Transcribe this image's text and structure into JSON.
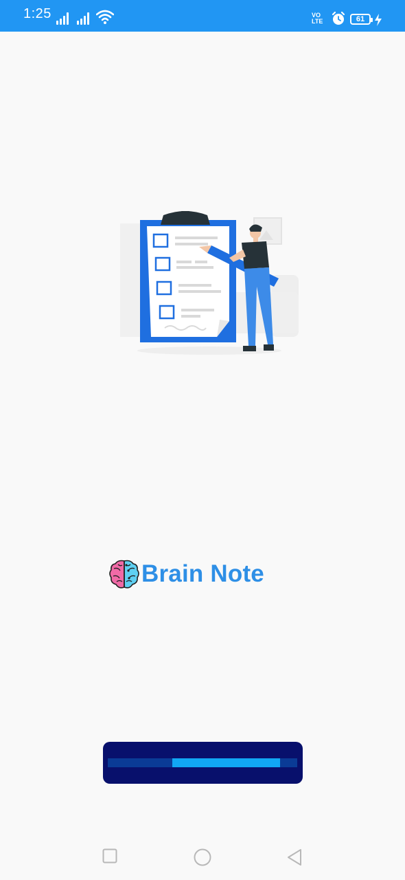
{
  "status_bar": {
    "time": "1:25",
    "volte_line1": "VO",
    "volte_line2": "LTE",
    "battery_level": "61",
    "background_color": "#2196f3"
  },
  "illustration": {
    "icon": "clipboard-checklist-illustration"
  },
  "brand": {
    "logo_icon": "brain-icon",
    "title": "Brain Note",
    "title_color": "#2e8fe6"
  },
  "progress": {
    "state": "indeterminate",
    "segment_start_fraction": 0.34,
    "segment_end_fraction": 0.91,
    "track_color": "#0a3b96",
    "fill_color": "#11a7f4",
    "card_color": "#08106c"
  },
  "nav_bar": {
    "recents_icon": "square-icon",
    "home_icon": "circle-icon",
    "back_icon": "triangle-back-icon"
  }
}
